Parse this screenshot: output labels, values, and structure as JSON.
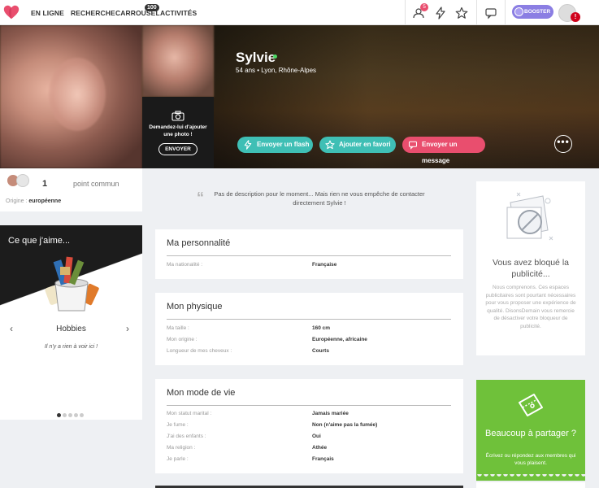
{
  "nav": {
    "items": [
      "EN LIGNE",
      "RECHERCHE",
      "CARROUSEL",
      "ACTIVITÉS"
    ],
    "carrousel_badge": "100",
    "notif_badge": "5",
    "booster": "BOOSTER",
    "avatar_alert": "!"
  },
  "profile": {
    "name": "Sylvie",
    "info": "54 ans • Lyon,  Rhône-Alpes",
    "ask_photo": "Demandez-lui d'ajouter une photo !",
    "ask_button": "ENVOYER",
    "actions": {
      "flash": "Envoyer un flash",
      "favori": "Ajouter en favori",
      "message": "Envoyer un message"
    },
    "more": "•••"
  },
  "common": {
    "count": "1",
    "label": "point commun",
    "origin_label": "Origine : ",
    "origin_value": "européenne"
  },
  "likes": {
    "title": "Ce que j'aime...",
    "category": "Hobbies",
    "prev": "‹",
    "next": "›",
    "empty": "Il n'y a rien à voir ici !"
  },
  "description": "Pas de description pour le moment... Mais rien ne vous empêche de contacter directement Sylvie !",
  "sections": {
    "personnalite": {
      "title": "Ma personnalité",
      "rows": [
        {
          "k": "Ma nationalité :",
          "v": "Française"
        }
      ]
    },
    "physique": {
      "title": "Mon physique",
      "rows": [
        {
          "k": "Ma taille :",
          "v": "160 cm"
        },
        {
          "k": "Mon origine :",
          "v": "Européenne, africaine"
        },
        {
          "k": "Longueur de mes cheveux :",
          "v": "Courts"
        }
      ]
    },
    "vie": {
      "title": "Mon mode de vie",
      "rows": [
        {
          "k": "Mon statut marital :",
          "v": "Jamais mariée"
        },
        {
          "k": "Je fume :",
          "v": "Non (n'aime pas la fumée)"
        },
        {
          "k": "J'ai des enfants :",
          "v": "Oui"
        },
        {
          "k": "Ma religion :",
          "v": "Athée"
        },
        {
          "k": "Je parle :",
          "v": "Français"
        }
      ]
    }
  },
  "adblock": {
    "title": "Vous avez bloqué la publicité...",
    "text": "Nous comprenons. Ces espaces publicitaires sont pourtant nécessaires pour vous proposer une expérience de qualité. DisonsDemain vous remercie de désactiver votre bloqueur de publicité."
  },
  "share": {
    "title": "Beaucoup à partager ?",
    "text": "Écrivez ou répondez aux membres qui vous plaisent."
  },
  "colors": {
    "flash": "#3fbfb5",
    "favori": "#3fbfb5",
    "message": "#e94e6e",
    "booster": "#8b7ee3",
    "share": "#6fc13a"
  }
}
